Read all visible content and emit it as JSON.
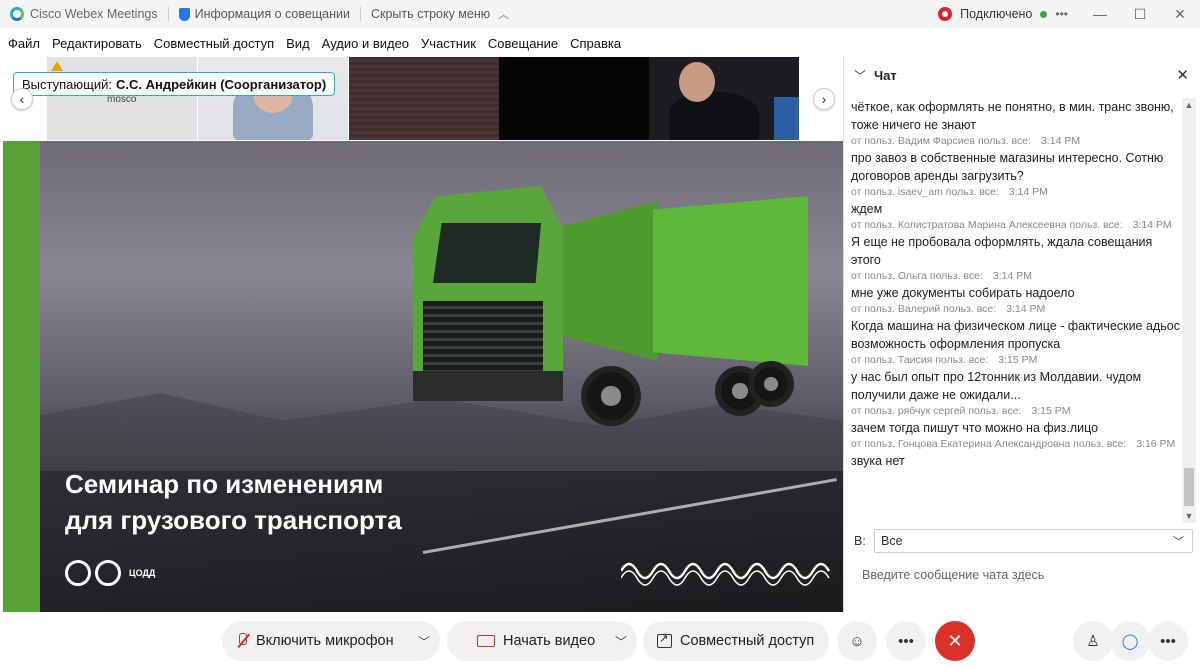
{
  "titlebar": {
    "app_name": "Cisco Webex Meetings",
    "meeting_info": "Информация о совещании",
    "hide_menu": "Скрыть строку меню",
    "status": "Подключено",
    "more": "•••"
  },
  "menu": [
    "Файл",
    "Редактировать",
    "Совместный доступ",
    "Вид",
    "Аудио и видео",
    "Участник",
    "Совещание",
    "Справка"
  ],
  "strip": {
    "speaker_prefix": "Выступающий:",
    "speaker_name": "С.С. Андрейкин (Соорганизатор)",
    "thumb1_label": "mosco"
  },
  "slide": {
    "title_line1": "Семинар по изменениям",
    "title_line2": "для грузового транспорта",
    "brand": "ЦОДД",
    "accent_color": "#57a135"
  },
  "chat": {
    "title": "Чат",
    "messages": [
      {
        "text": "чёткое, как оформлять не понятно, в мин. транс звоню, тоже ничего не знают",
        "meta": "от польз. Вадим Фарсиев польз. все:",
        "time": "3:14 PM"
      },
      {
        "text": "про завоз в собственные магазины интересно. Сотню договоров аренды загрузить?",
        "meta": "от польз. isaev_am польз. все:",
        "time": "3:14 PM"
      },
      {
        "text": "ждем",
        "meta": "от польз. Колистратова Марина Алексеевна польз. все:",
        "time": "3:14 PM"
      },
      {
        "text": "Я еще не пробовала оформлять, ждала совещания этого",
        "meta": "от польз. Ольга польз. все:",
        "time": "3:14 PM"
      },
      {
        "text": "мне уже документы собирать надоело",
        "meta": "от польз. Валерий польз. все:",
        "time": "3:14 PM"
      },
      {
        "text": "Когда машина на физическом лице - фактические адьос возможность оформления пропуска",
        "meta": "от польз. Таисия польз. все:",
        "time": "3:15 PM"
      },
      {
        "text": "у нас был опыт про 12тонник из Молдавии. чудом получили даже не ожидали...",
        "meta": "от польз. рябчук сергей польз. все:",
        "time": "3:15 PM"
      },
      {
        "text": "зачем тогда пишут что можно на физ.лицо",
        "meta": "от польз. Гонцова Екатерина Александровна польз. все:",
        "time": "3:16 PM"
      },
      {
        "text": "звука нет",
        "meta": "",
        "time": ""
      }
    ],
    "to_label": "В:",
    "to_value": "Все",
    "input_placeholder": "Введите сообщение чата здесь"
  },
  "toolbar": {
    "mic_label": "Включить микрофон",
    "video_label": "Начать видео",
    "share_label": "Совместный доступ"
  }
}
